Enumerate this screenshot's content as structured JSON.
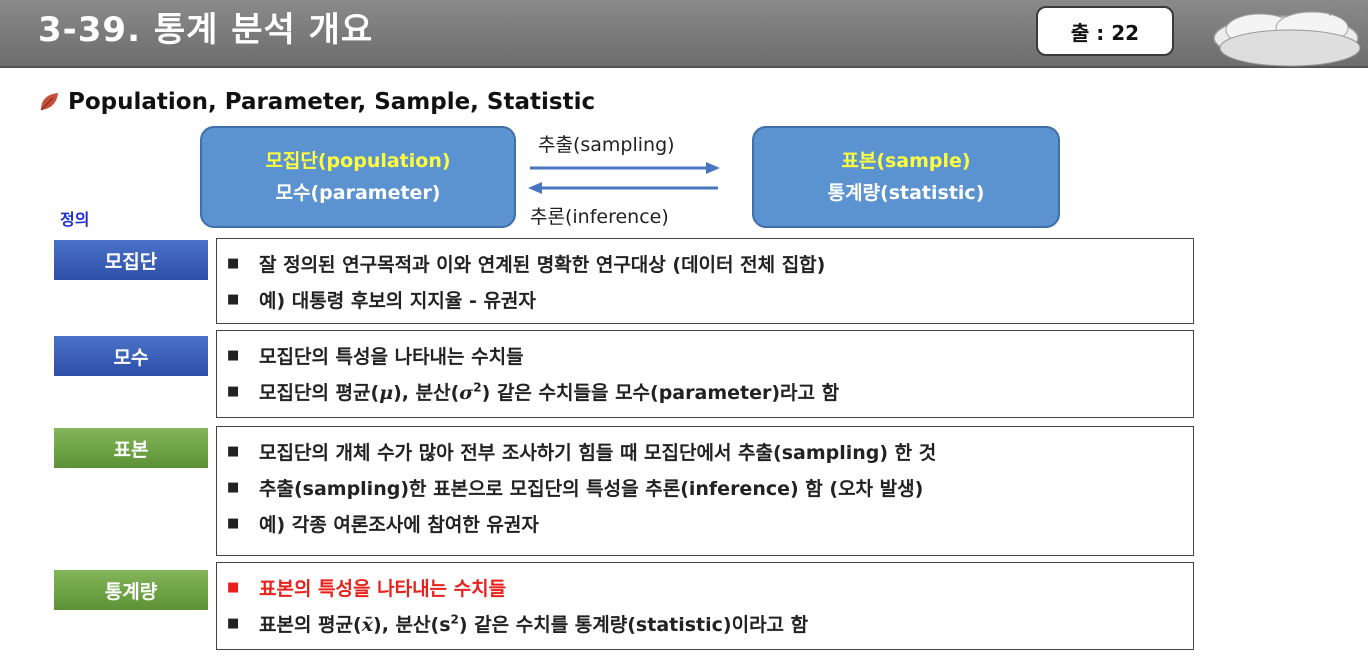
{
  "header": {
    "title": "3-39. 통계 분석 개요",
    "source_badge": "출 : 22"
  },
  "subtitle": {
    "icon": "leaf-icon",
    "text": "Population, Parameter, Sample, Statistic"
  },
  "diagram": {
    "population_box": {
      "line1": "모집단(population)",
      "line2": "모수(parameter)"
    },
    "sample_box": {
      "line1": "표본(sample)",
      "line2": "통계량(statistic)"
    },
    "arrow_forward_label": "추출(sampling)",
    "arrow_back_label": "추론(inference)"
  },
  "definition_label": "정의",
  "definitions": [
    {
      "term": "모집단",
      "color": "blue",
      "bullets": [
        "잘 정의된 연구목적과 이와 연계된 명확한 연구대상 (데이터 전체 집합)",
        "예) 대통령 후보의 지지율 - 유권자"
      ]
    },
    {
      "term": "모수",
      "color": "blue",
      "bullets": [
        "모집단의 특성을 나타내는 수치들"
      ],
      "formula_bullet": {
        "part1": "모집단의 평균(",
        "mu": "μ",
        "part2": "), 분산(",
        "sigma": "σ",
        "sup": "2",
        "part3": ") 같은 수치들을 모수(parameter)라고 함"
      }
    },
    {
      "term": "표본",
      "color": "green",
      "bullets": [
        "모집단의 개체 수가 많아 전부 조사하기 힘들 때 모집단에서 추출(sampling) 한 것",
        "추출(sampling)한 표본으로 모집단의 특성을 추론(inference) 함 (오차 발생)",
        "예) 각종 여론조사에 참여한 유권자"
      ]
    },
    {
      "term": "통계량",
      "color": "green",
      "red_bullet": "표본의 특성을 나타내는 수치들",
      "formula_bullet": {
        "part1": "표본의 평균(",
        "xbar": "x̄",
        "part2": "), 분산(s",
        "sup": "2",
        "part3": ") 같은 수치를 통계량(statistic)이라고 함"
      }
    }
  ],
  "colors": {
    "header_bg": "#7a7a7a",
    "concept_box": "#5b92d0",
    "term_blue": "#3a5fb8",
    "term_green": "#6fa444",
    "highlight_red": "#e8211c",
    "highlight_yellow": "#ffff40"
  }
}
